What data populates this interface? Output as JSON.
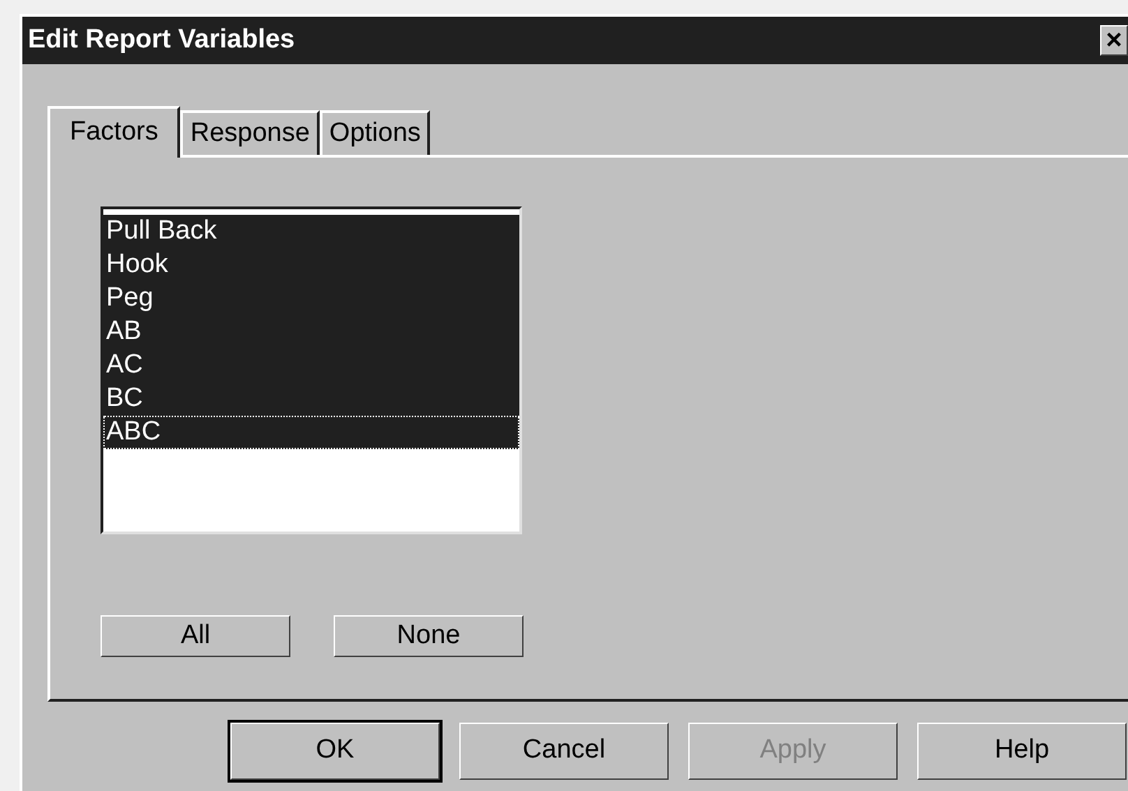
{
  "window": {
    "title": "Edit Report Variables",
    "close": "×"
  },
  "tabs": [
    {
      "label": "Factors",
      "selected": true
    },
    {
      "label": "Response",
      "selected": false
    },
    {
      "label": "Options",
      "selected": false
    }
  ],
  "factors_list": [
    {
      "label": "Pull Back",
      "selected": true,
      "focused": false
    },
    {
      "label": "Hook",
      "selected": true,
      "focused": false
    },
    {
      "label": "Peg",
      "selected": true,
      "focused": false
    },
    {
      "label": "AB",
      "selected": true,
      "focused": false
    },
    {
      "label": "AC",
      "selected": true,
      "focused": false
    },
    {
      "label": "BC",
      "selected": true,
      "focused": false
    },
    {
      "label": "ABC",
      "selected": true,
      "focused": true
    }
  ],
  "select_buttons": [
    "All",
    "None"
  ],
  "buttons": [
    {
      "label": "OK",
      "default": true,
      "disabled": false
    },
    {
      "label": "Cancel",
      "default": false,
      "disabled": false
    },
    {
      "label": "Apply",
      "default": false,
      "disabled": true
    },
    {
      "label": "Help",
      "default": false,
      "disabled": false
    }
  ]
}
